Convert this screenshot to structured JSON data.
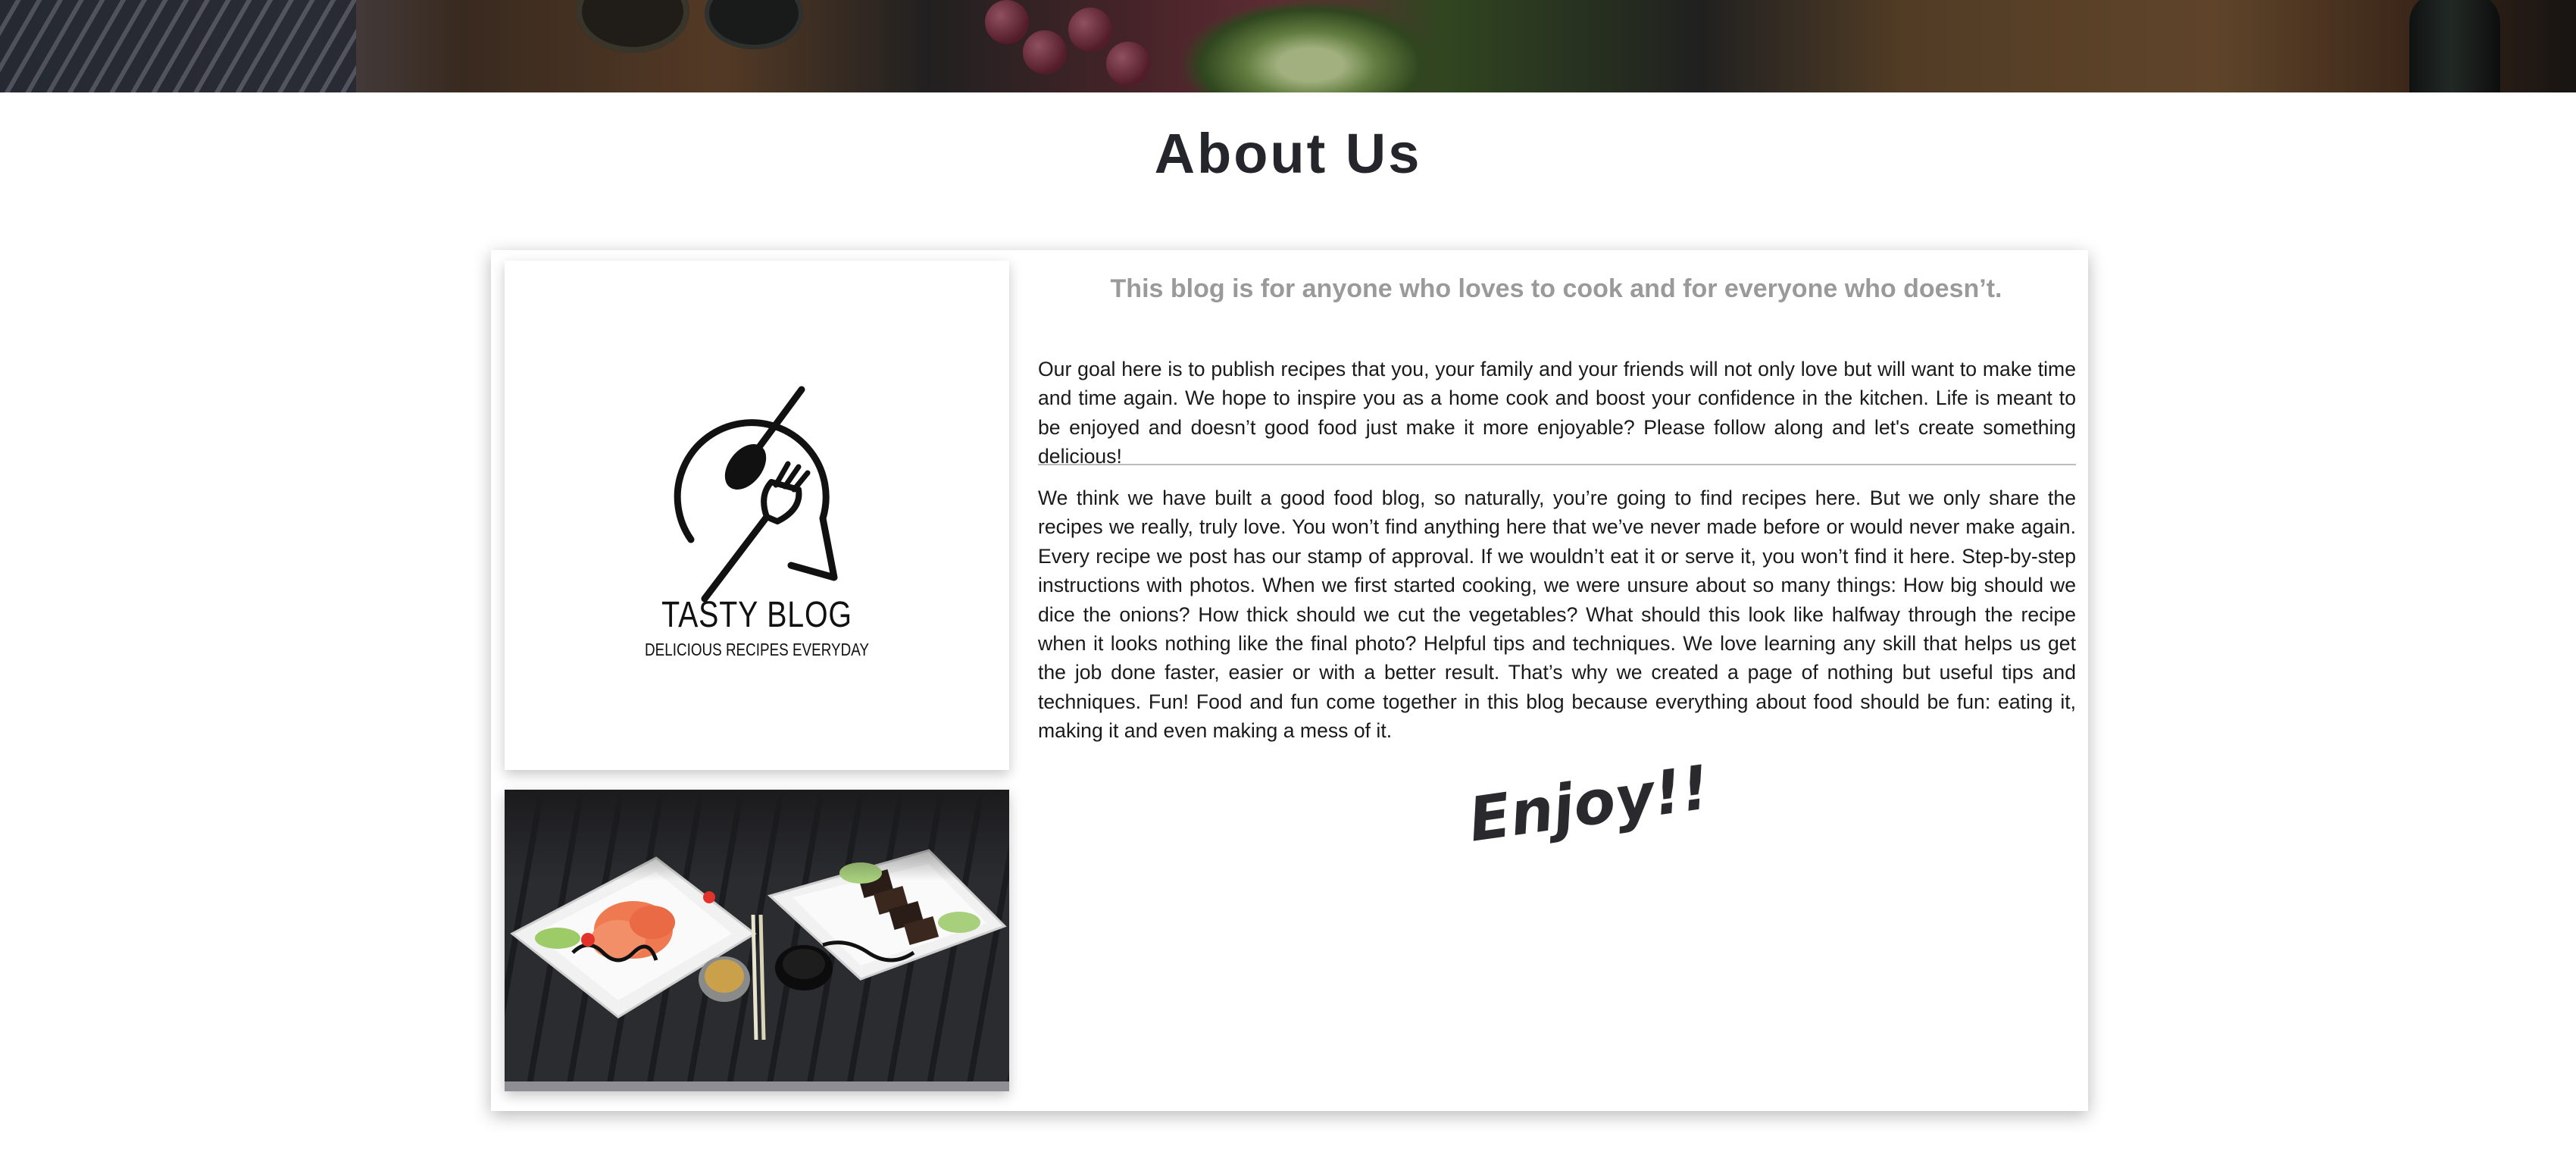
{
  "page": {
    "title": "About Us"
  },
  "hero": {
    "image": "food-table-banner"
  },
  "logo": {
    "name": "TASTY BLOG",
    "tagline": "DELICIOUS RECIPES EVERYDAY",
    "icon": "spoon-fork-speech-bubble-icon"
  },
  "photo": {
    "image": "sashimi-plates-photo"
  },
  "content": {
    "tagline": "This blog is for anyone who loves to cook and for everyone who doesn’t.",
    "paragraph1": "Our goal here is to publish recipes that you, your family and your friends will not only love but will want to make time and time again. We hope to inspire you as a home cook and boost your confidence in the kitchen. Life is meant to be enjoyed and doesn’t good food just make it more enjoyable? Please follow along and let's create something delicious!",
    "paragraph2": "We think we have built a good food blog, so naturally, you’re going to find recipes here. But we only share the recipes we really, truly love. You won’t find anything here that we’ve never made before or would never make again. Every recipe we post has our stamp of approval. If we wouldn’t eat it or serve it, you won’t find it here. Step-by-step instructions with photos. When we first started cooking, we were unsure about so many things: How big should we dice the onions? How thick should we cut the vegetables? What should this look like halfway through the recipe when it looks nothing like the final photo? Helpful tips and techniques. We love learning any skill that helps us get the job done faster, easier or with a better result. That’s why we created a page of nothing but useful tips and techniques. Fun! Food and fun come together in this blog because everything about food should be fun: eating it, making it and even making a mess of it.",
    "signoff": "Enjoy!!"
  }
}
